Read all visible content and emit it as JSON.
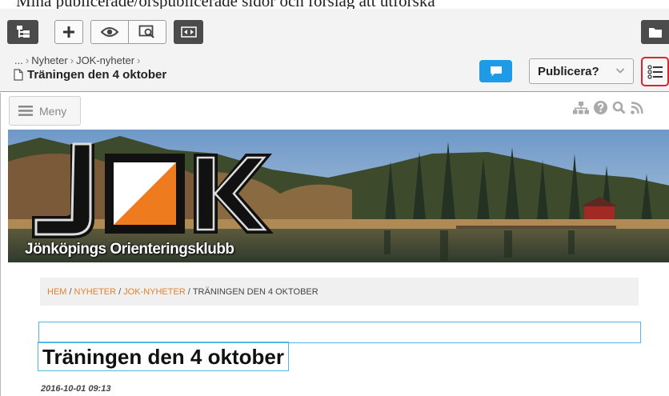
{
  "banner_tooltip": {
    "text": "Mina publicerade/orspublicerade sidor och förslag att utforska"
  },
  "toolbar": {
    "tree_icon": "site-tree-icon",
    "add_icon": "plus-icon",
    "view_icon": "eye-icon",
    "preview_icon": "preview-search-icon",
    "width_icon": "resize-horizontal-icon",
    "folder_icon": "folder-icon"
  },
  "breadcrumb": {
    "ellipsis": "...",
    "items": [
      "Nyheter",
      "JOK-nyheter"
    ]
  },
  "page": {
    "name": "Träningen den 4 oktober"
  },
  "actions": {
    "chat_icon": "speech-bubble-icon",
    "publish_label": "Publicera?",
    "list_icon": "list-icon"
  },
  "site": {
    "menu_label": "Meny",
    "header_icons": [
      "sitemap-icon",
      "help-icon",
      "search-icon",
      "rss-icon"
    ],
    "club_logo_text": "JOK",
    "club_name": "Jönköpings Orienteringsklubb",
    "breadcrumb": {
      "home": "HEM",
      "news": "NYHETER",
      "jok_news": "JOK-NYHETER",
      "current": "TRÄNINGEN DEN 4 OKTOBER"
    },
    "article": {
      "title": "Träningen den 4 oktober",
      "date": "2016-10-01 09:13"
    }
  },
  "colors": {
    "accent_blue": "#1e9be6",
    "highlight_red": "#e0212f",
    "link_orange": "#e8812a",
    "edit_outline": "#53b7e6"
  }
}
